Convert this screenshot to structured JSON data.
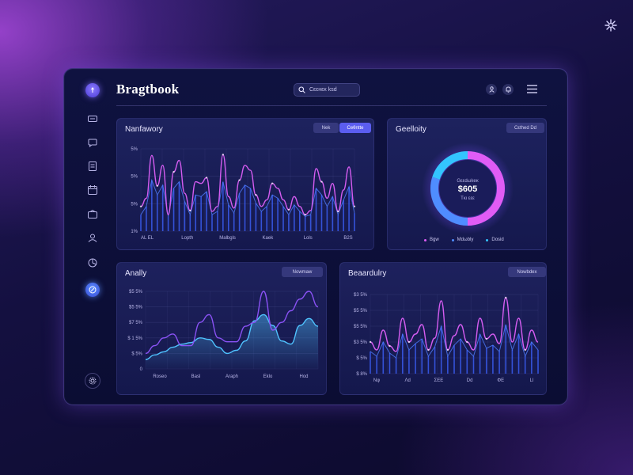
{
  "app_title": "Bragtbook",
  "search": {
    "text": "Cεεнεκ ksd"
  },
  "panels": {
    "top_left": {
      "title": "Nanfawory",
      "toggle": [
        "Nek",
        "Ceθntte"
      ],
      "chart_data": {
        "type": "line",
        "x_labels": [
          "AL EL",
          "Lopth",
          "Malbgls",
          "Kaek",
          "Lols",
          "B2S"
        ],
        "y_ticks": [
          "5%",
          "5%",
          "5%",
          "1%"
        ],
        "ylim": [
          0,
          100
        ],
        "series": [
          {
            "values": [
              30,
              40,
              92,
              55,
              80,
              20,
              72,
              86,
              46,
              25,
              60,
              58,
              65,
              24,
              30,
              93,
              42,
              28,
              62,
              80,
              74,
              44,
              30,
              38,
              58,
              52,
              38,
              26,
              42,
              30,
              20,
              25,
              76,
              60,
              40,
              58,
              24,
              50,
              78,
              30
            ]
          },
          {
            "values": [
              20,
              30,
              62,
              44,
              56,
              18,
              52,
              60,
              36,
              20,
              44,
              42,
              48,
              20,
              24,
              60,
              32,
              22,
              46,
              56,
              52,
              34,
              24,
              30,
              44,
              40,
              30,
              20,
              32,
              24,
              18,
              20,
              52,
              44,
              30,
              42,
              20,
              38,
              54,
              22
            ]
          }
        ]
      }
    },
    "top_right": {
      "title": "Geelloity",
      "button": "Cεthed Dd",
      "chart_data": {
        "type": "pie",
        "center_label": "Gεεdωkeκ",
        "center_value": "$605",
        "center_sub": "Tκι εεε",
        "slices": [
          {
            "name": "Bgw",
            "value": 50,
            "color": "#e05cf5"
          },
          {
            "name": "Mdωbly",
            "value": 30,
            "color": "#4f8dff"
          },
          {
            "name": "Dosid",
            "value": 20,
            "color": "#33c5ff"
          }
        ]
      }
    },
    "bottom_left": {
      "title": "Anally",
      "button": "Nowmaw",
      "chart_data": {
        "type": "area",
        "x_labels": [
          "Roseo",
          "Basl",
          "Araph",
          "Eklo",
          "Hod"
        ],
        "y_ticks": [
          "$5 5%",
          "$5 5%",
          "$7 5%",
          "$ 1 5%",
          "$ 5%",
          "0"
        ],
        "ylim": [
          0,
          100
        ],
        "series": [
          {
            "values": [
              20,
              30,
              40,
              45,
              30,
              30,
              60,
              70,
              40,
              35,
              35,
              55,
              60,
              100,
              50,
              60,
              75,
              90,
              100,
              80
            ]
          },
          {
            "values": [
              12,
              18,
              22,
              28,
              32,
              34,
              40,
              38,
              28,
              20,
              24,
              36,
              62,
              70,
              56,
              36,
              32,
              56,
              65,
              55
            ]
          }
        ]
      }
    },
    "bottom_right": {
      "title": "Beaardulry",
      "button": "Nowbdex",
      "chart_data": {
        "type": "line",
        "x_labels": [
          "Nφ",
          "Λd",
          "ΣΕΕ",
          "Dd",
          "ΦΕ",
          "Ll"
        ],
        "y_ticks": [
          "$3 5%",
          "$5 5%",
          "$5 5%",
          "$3 5%",
          "$ 5%",
          "$ 8%"
        ],
        "ylim": [
          0,
          100
        ],
        "series": [
          {
            "values": [
              40,
              30,
              55,
              35,
              28,
              70,
              40,
              50,
              62,
              30,
              45,
              92,
              30,
              48,
              62,
              40,
              30,
              70,
              44,
              50,
              38,
              96,
              40,
              70,
              30,
              55,
              40
            ]
          },
          {
            "values": [
              28,
              22,
              40,
              26,
              20,
              50,
              30,
              38,
              44,
              22,
              34,
              60,
              22,
              36,
              44,
              30,
              22,
              50,
              32,
              36,
              28,
              62,
              30,
              50,
              22,
              40,
              30
            ]
          }
        ]
      }
    }
  },
  "colors": {
    "magenta": "#d45cf0",
    "blue": "#3f6bff",
    "cyan": "#4fc3ff",
    "accent": "#5b5df0"
  },
  "icons": [
    "logo-icon",
    "list-icon",
    "chat-icon",
    "document-icon",
    "calendar-icon",
    "mail-icon",
    "users-icon",
    "chart-icon",
    "globe-icon",
    "settings-icon",
    "search-icon",
    "user-icon",
    "bell-icon",
    "menu-icon",
    "sparkle-icon"
  ]
}
